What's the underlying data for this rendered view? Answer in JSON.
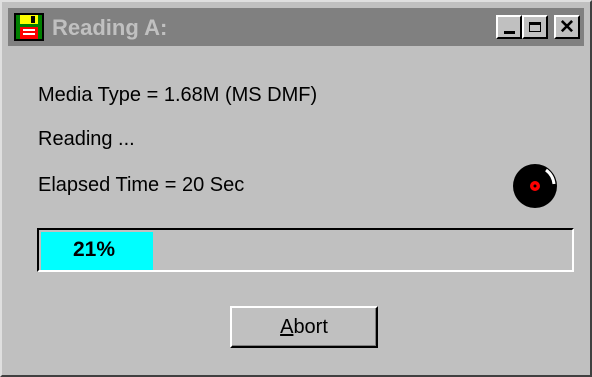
{
  "window": {
    "title": "Reading A:",
    "app_icon": "floppy-disk-icon",
    "controls": {
      "minimize_icon": "minimize-icon",
      "maximize_icon": "maximize-icon",
      "close_icon": "close-icon"
    }
  },
  "status": {
    "media_type": "Media Type = 1.68M (MS DMF)",
    "activity": "Reading ...",
    "elapsed": "Elapsed Time =  20 Sec",
    "activity_icon": "spinning-disk-icon"
  },
  "progress": {
    "percent": 21,
    "label": "21%",
    "fill_color": "#00ffff"
  },
  "actions": {
    "abort_mnemonic": "A",
    "abort_rest": "bort"
  },
  "colors": {
    "face": "#c0c0c0",
    "inactive_titlebar": "#808080",
    "progress_fill": "#00ffff"
  }
}
